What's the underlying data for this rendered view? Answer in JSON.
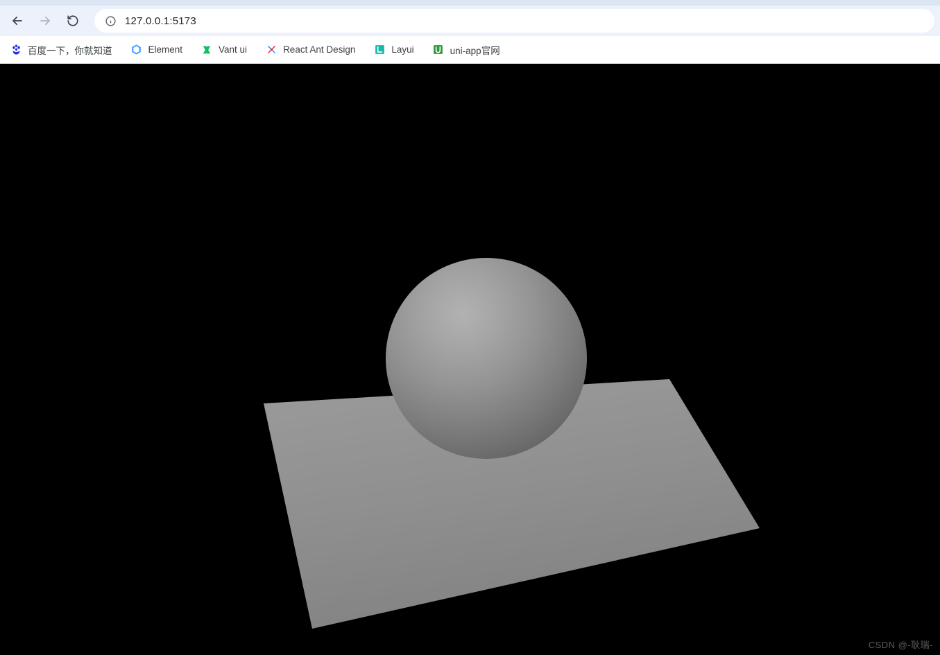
{
  "browser": {
    "url": "127.0.0.1:5173",
    "nav": {
      "back_enabled": true,
      "forward_enabled": false
    }
  },
  "bookmarks": [
    {
      "label": "百度一下，你就知道",
      "icon": "baidu-icon",
      "icon_color": "#2932e1"
    },
    {
      "label": "Element",
      "icon": "element-icon",
      "icon_color": "#409eff"
    },
    {
      "label": "Vant ui",
      "icon": "vant-icon",
      "icon_color": "#07c160"
    },
    {
      "label": "React Ant Design",
      "icon": "antd-icon",
      "icon_color": "#f5222d"
    },
    {
      "label": "Layui",
      "icon": "layui-icon",
      "icon_color": "#16baaa"
    },
    {
      "label": "uni-app官网",
      "icon": "uniapp-icon",
      "icon_color": "#2b9939"
    }
  ],
  "scene": {
    "background": "#000000",
    "objects": [
      {
        "type": "plane",
        "color": "#8e8e8e"
      },
      {
        "type": "sphere",
        "color": "#8e8e8e"
      }
    ]
  },
  "watermark": "CSDN @-耿瑞-"
}
